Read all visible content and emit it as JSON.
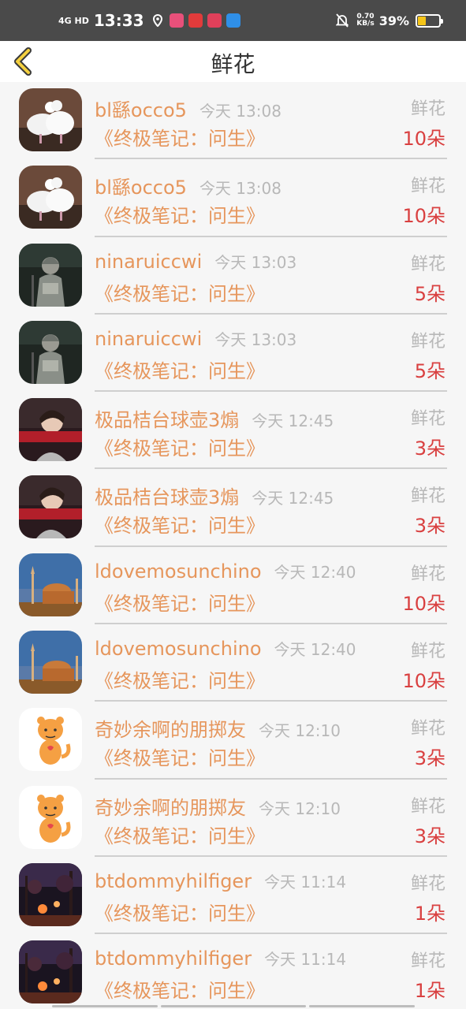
{
  "status_bar": {
    "network": "4G HD",
    "time": "13:33",
    "speed_value": "0.70",
    "speed_unit": "KB/s",
    "battery_percent": "39%",
    "battery_level": 0.39,
    "battery_color": "#f5c518"
  },
  "header": {
    "title": "鲜花",
    "back_icon": "chevron-left-icon"
  },
  "colors": {
    "name": "#e6965c",
    "time": "#b8b8b8",
    "count": "#d94040"
  },
  "records": [
    {
      "user": "bl繇occo5",
      "time": "今天 13:08",
      "book": "《终极笔记：问生》",
      "gift": "鲜花",
      "count": "10朵",
      "avatar": "doves"
    },
    {
      "user": "bl繇occo5",
      "time": "今天 13:08",
      "book": "《终极笔记：问生》",
      "gift": "鲜花",
      "count": "10朵",
      "avatar": "doves"
    },
    {
      "user": "ninaruiccwi",
      "time": "今天 13:03",
      "book": "《终极笔记：问生》",
      "gift": "鲜花",
      "count": "5朵",
      "avatar": "warrior"
    },
    {
      "user": "ninaruiccwi",
      "time": "今天 13:03",
      "book": "《终极笔记：问生》",
      "gift": "鲜花",
      "count": "5朵",
      "avatar": "warrior"
    },
    {
      "user": "极品桔台球壶3煽",
      "time": "今天 12:45",
      "book": "《终极笔记：问生》",
      "gift": "鲜花",
      "count": "3朵",
      "avatar": "portrait"
    },
    {
      "user": "极品桔台球壶3煽",
      "time": "今天 12:45",
      "book": "《终极笔记：问生》",
      "gift": "鲜花",
      "count": "3朵",
      "avatar": "portrait"
    },
    {
      "user": "ldovemosunchino",
      "time": "今天 12:40",
      "book": "《终极笔记：问生》",
      "gift": "鲜花",
      "count": "10朵",
      "avatar": "mosque"
    },
    {
      "user": "ldovemosunchino",
      "time": "今天 12:40",
      "book": "《终极笔记：问生》",
      "gift": "鲜花",
      "count": "10朵",
      "avatar": "mosque"
    },
    {
      "user": "奇妙余啊的朋掷友",
      "time": "今天 12:10",
      "book": "《终极笔记：问生》",
      "gift": "鲜花",
      "count": "3朵",
      "avatar": "tiger"
    },
    {
      "user": "奇妙余啊的朋掷友",
      "time": "今天 12:10",
      "book": "《终极笔记：问生》",
      "gift": "鲜花",
      "count": "3朵",
      "avatar": "tiger"
    },
    {
      "user": "btdommyhilfiger",
      "time": "今天 11:14",
      "book": "《终极笔记：问生》",
      "gift": "鲜花",
      "count": "1朵",
      "avatar": "night-street"
    },
    {
      "user": "btdommyhilfiger",
      "time": "今天 11:14",
      "book": "《终极笔记：问生》",
      "gift": "鲜花",
      "count": "1朵",
      "avatar": "night-street"
    }
  ]
}
